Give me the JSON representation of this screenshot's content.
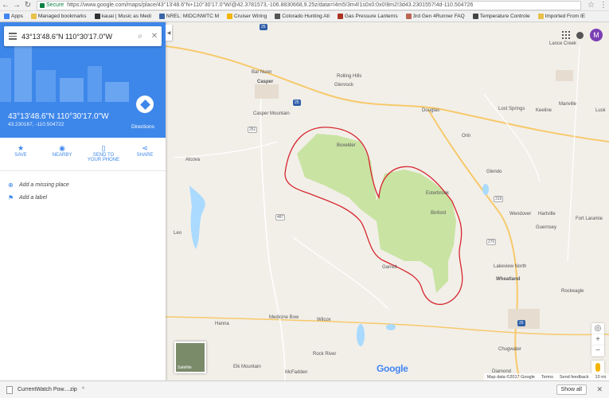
{
  "browser": {
    "secure_label": "Secure",
    "url": "https://www.google.com/maps/place/43°13'48.6\"N+110°30'17.0\"W/@42.3781573,-106.8830668,9.25z/data=!4m5!3m4!1s0x0:0x0!8m2!3d43.2301557!4d-110.504726",
    "bookmarks": [
      "Apps",
      "Managed bookmarks",
      "kauai | Music as Medi",
      "NREL: MIDC/NWTC M",
      "Cruiser Wiring",
      "Colorado Hunting Atl",
      "Gas Pressure Lanterns",
      "3rd Gen 4Runner FAQ",
      "Temperature Controle",
      "Imported From IE"
    ]
  },
  "sidebar": {
    "search_value": "43°13'48.6\"N 110°30'17.0\"W",
    "title": "43°13'48.6\"N 110°30'17.0\"W",
    "decimal": "43.230167, -110.504722",
    "directions_label": "Directions",
    "actions": [
      {
        "label": "SAVE",
        "icon": "star-icon"
      },
      {
        "label": "NEARBY",
        "icon": "nearby-icon"
      },
      {
        "label": "SEND TO YOUR PHONE",
        "icon": "phone-icon"
      },
      {
        "label": "SHARE",
        "icon": "share-icon"
      }
    ],
    "add_place": "Add a missing place",
    "add_label": "Add a label"
  },
  "map": {
    "avatar_initial": "M",
    "satellite_label": "Satellite",
    "google_logo": "Google",
    "footer": [
      "Map data ©2017 Google",
      "Terms",
      "Send feedback",
      "10 mi"
    ],
    "places": [
      "Lance Creek",
      "Bar Nunn",
      "Rolling Hills",
      "Casper",
      "Glenrock",
      "Douglas",
      "Lost Springs",
      "Keeline",
      "Manville",
      "Lusk",
      "Casper Mountain",
      "Orin",
      "Boxelder",
      "Alcova",
      "Glendo",
      "Esterbrook",
      "Binford",
      "Wendover",
      "Hartville",
      "Guernsey",
      "Fort Laramie",
      "Leo",
      "Garrett",
      "Lakeview North",
      "Wheatland",
      "Rockeagle",
      "Hanna",
      "Medicine Bow",
      "Wilcox",
      "Rock River",
      "Chugwater",
      "Elk Mountain",
      "McFadden",
      "Diamond"
    ]
  },
  "downloads": {
    "file": "CurrentWatch Pow....zip",
    "show_all": "Show all"
  },
  "colors": {
    "accent": "#3e87ea",
    "forest": "#c9e3a3",
    "boundary": "#d7262e",
    "land": "#f2efe9"
  }
}
